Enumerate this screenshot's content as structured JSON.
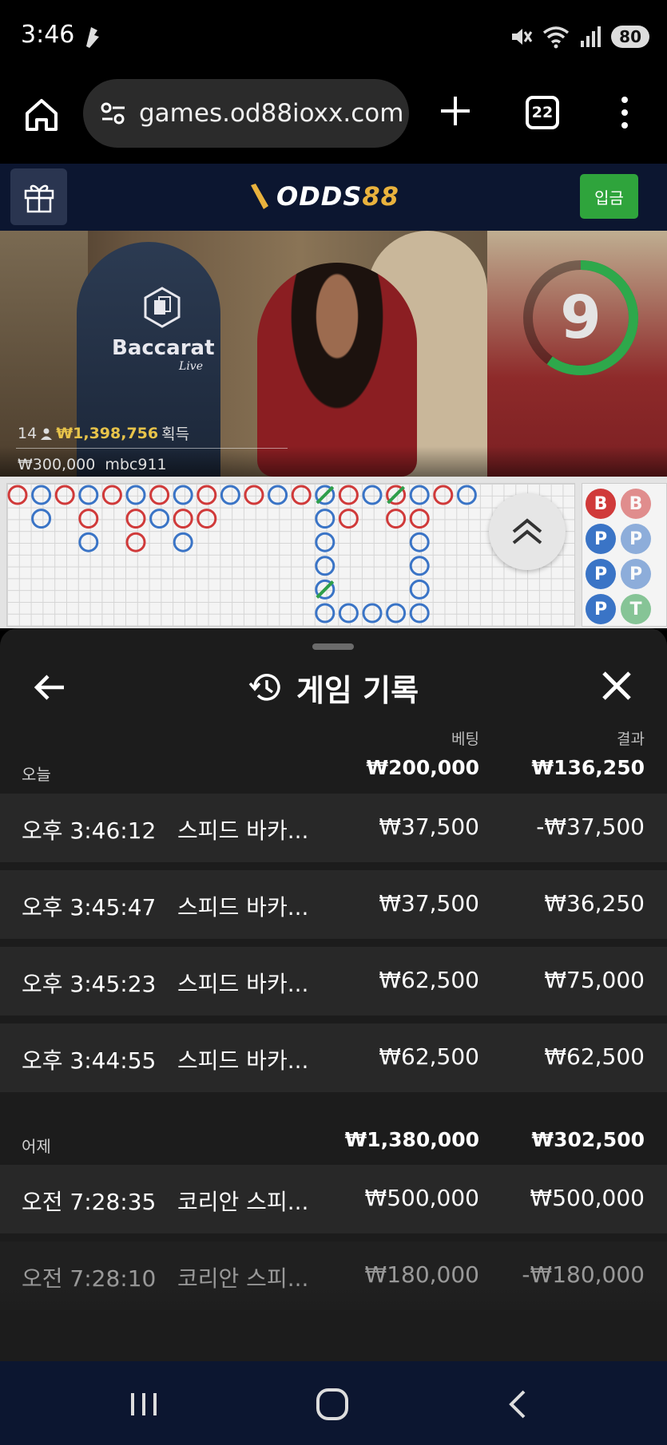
{
  "status_bar": {
    "time": "3:46",
    "battery": "80"
  },
  "browser": {
    "url": "games.od88ioxx.com",
    "tab_count": "22"
  },
  "site_header": {
    "logo_text_white": "ODDS",
    "logo_text_gold": "88",
    "deposit_label": "입금",
    "colors": {
      "header_bg": "#0c1630",
      "deposit_green": "#2fa43c",
      "logo_gold": "#e9b23d"
    }
  },
  "live_table": {
    "logo_title": "Baccarat",
    "logo_subtitle": "Live",
    "countdown": "9",
    "countdown_fraction_remaining": 0.6,
    "players_count": "14",
    "players_winnings": "₩1,398,756",
    "winnings_label": "획득",
    "last_bet": "₩300,000",
    "last_user": "mbc911"
  },
  "roadmap": {
    "bead_colors": {
      "banker": "#d03a3a",
      "player": "#3a74c6",
      "tie": "#2e9e4a"
    },
    "side_beads": [
      "B",
      "B",
      "P",
      "P",
      "P",
      "P",
      "P",
      "T"
    ]
  },
  "history": {
    "title": "게임 기록",
    "col_bet": "베팅",
    "col_result": "결과",
    "groups": [
      {
        "label": "오늘",
        "total_bet": "₩200,000",
        "total_result": "₩136,250",
        "rows": [
          {
            "time": "오후 3:46:12",
            "game": "스피드 바카...",
            "bet": "₩37,500",
            "result": "-₩37,500"
          },
          {
            "time": "오후 3:45:47",
            "game": "스피드 바카...",
            "bet": "₩37,500",
            "result": "₩36,250"
          },
          {
            "time": "오후 3:45:23",
            "game": "스피드 바카...",
            "bet": "₩62,500",
            "result": "₩75,000"
          },
          {
            "time": "오후 3:44:55",
            "game": "스피드 바카...",
            "bet": "₩62,500",
            "result": "₩62,500"
          }
        ]
      },
      {
        "label": "어제",
        "total_bet": "₩1,380,000",
        "total_result": "₩302,500",
        "rows": [
          {
            "time": "오전 7:28:35",
            "game": "코리안 스피...",
            "bet": "₩500,000",
            "result": "₩500,000"
          },
          {
            "time": "오전 7:28:10",
            "game": "코리안 스피...",
            "bet": "₩180,000",
            "result": "-₩180,000"
          }
        ]
      }
    ]
  }
}
